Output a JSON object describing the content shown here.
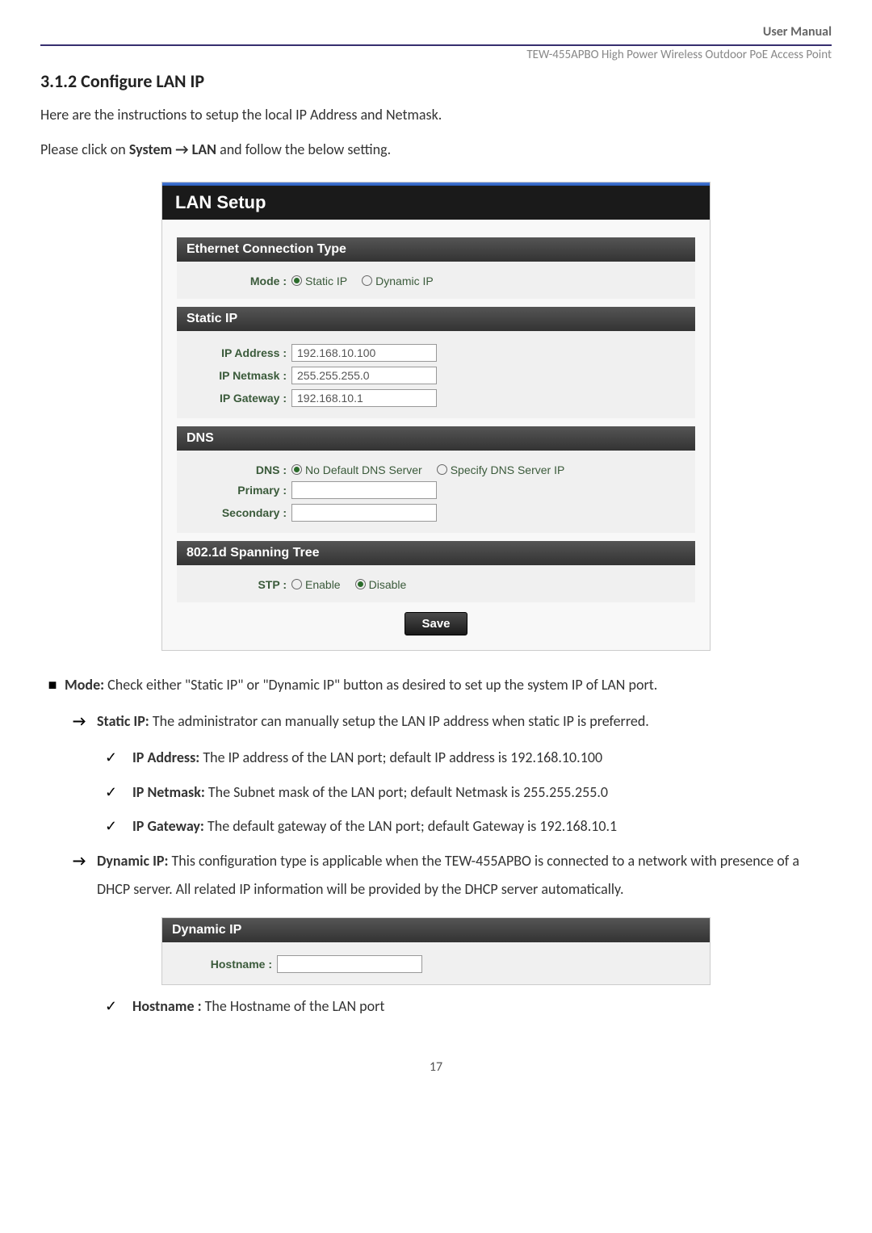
{
  "header": {
    "label": "User Manual",
    "subtext": "TEW-455APBO High Power Wireless Outdoor PoE Access Point"
  },
  "section_title": "3.1.2 Configure LAN IP",
  "intro": {
    "p1": "Here are the instructions to setup the local IP Address and Netmask.",
    "p2_prefix": "Please click on ",
    "p2_bold": "System → LAN",
    "p2_suffix": " and follow the below setting."
  },
  "lan_setup": {
    "title": "LAN Setup",
    "ethernet": {
      "header": "Ethernet Connection Type",
      "mode_label": "Mode",
      "static_ip": "Static IP",
      "dynamic_ip": "Dynamic IP"
    },
    "static_ip": {
      "header": "Static IP",
      "ip_address_label": "IP Address",
      "ip_address_value": "192.168.10.100",
      "ip_netmask_label": "IP Netmask",
      "ip_netmask_value": "255.255.255.0",
      "ip_gateway_label": "IP Gateway",
      "ip_gateway_value": "192.168.10.1"
    },
    "dns": {
      "header": "DNS",
      "dns_label": "DNS",
      "no_default": "No Default DNS Server",
      "specify": "Specify DNS Server IP",
      "primary_label": "Primary",
      "secondary_label": "Secondary"
    },
    "spanning": {
      "header": "802.1d Spanning Tree",
      "stp_label": "STP",
      "enable": "Enable",
      "disable": "Disable"
    },
    "save": "Save"
  },
  "bullets": {
    "mode_bold": "Mode:",
    "mode_text": " Check either \"Static IP\" or \"Dynamic IP\" button as desired to set up the system IP of LAN port.",
    "static_bold": "Static IP:",
    "static_text": " The administrator can manually setup the LAN IP address when static IP is preferred.",
    "ip_addr_bold": "IP Address:",
    "ip_addr_text": " The IP address of the LAN port; default IP address is 192.168.10.100",
    "ip_netmask_bold": "IP Netmask:",
    "ip_netmask_text": " The Subnet mask of the LAN port; default Netmask is 255.255.255.0",
    "ip_gateway_bold": "IP Gateway:",
    "ip_gateway_text": " The default gateway of the LAN port; default Gateway is 192.168.10.1",
    "dynamic_bold": "Dynamic IP:",
    "dynamic_text": " This configuration type is applicable when the TEW-455APBO is connected to a network with presence of a DHCP server. All related IP information will be provided by the DHCP server automatically.",
    "hostname_bold": "Hostname :",
    "hostname_text": " The Hostname of the LAN port"
  },
  "dynamic_panel": {
    "header": "Dynamic IP",
    "hostname_label": "Hostname"
  },
  "page_number": "17"
}
